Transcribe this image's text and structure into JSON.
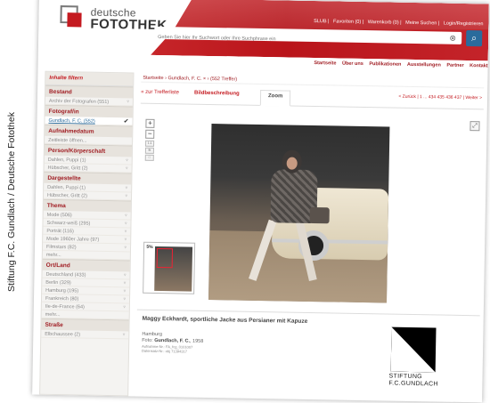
{
  "credit": "Stiftung F.C. Gundlach / Deutsche Fotothek",
  "logo": {
    "line1": "deutsche",
    "line2": "FOTOTHEK"
  },
  "topnav": [
    "SLUB",
    "Favoriten (0)",
    "Warenkorb (0)",
    "Meine Suchen",
    "Login/Registrieren"
  ],
  "search": {
    "placeholder": "Geben Sie hier Ihr Suchwort oder Ihre Suchphrase ein",
    "clear_icon": "close-icon",
    "button_icon": "search-icon"
  },
  "mainnav": [
    "Startseite",
    "Über uns",
    "Publikationen",
    "Ausstellungen",
    "Partner",
    "Kontakt"
  ],
  "sidebar": {
    "title": "Inhalte filtern",
    "sections": [
      {
        "label": "Bestand",
        "items": [
          {
            "text": "Archiv der Fotografen (551)",
            "mark": "▿"
          }
        ]
      },
      {
        "label": "Fotograf/in",
        "items": [
          {
            "text": "Gundlach, F. C. (552)",
            "mark": "✔",
            "active": true
          }
        ]
      },
      {
        "label": "Aufnahmedatum",
        "items": [
          {
            "text": "Zeitleiste öffnen...",
            "mark": ""
          }
        ]
      },
      {
        "label": "Person/Körperschaft",
        "items": [
          {
            "text": "Dahlen, Puppi (1)",
            "mark": "▿"
          },
          {
            "text": "Hübscher, Gritt (2)",
            "mark": "▿"
          }
        ]
      },
      {
        "label": "Dargestellte",
        "items": [
          {
            "text": "Dahlen, Puppi (1)",
            "mark": "▿"
          },
          {
            "text": "Hübscher, Gritt (2)",
            "mark": "▿"
          }
        ]
      },
      {
        "label": "Thema",
        "items": [
          {
            "text": "Mode (506)",
            "mark": "▿"
          },
          {
            "text": "Schwarz-weiß (295)",
            "mark": "▿"
          },
          {
            "text": "Porträt (116)",
            "mark": "▿"
          },
          {
            "text": "Mode 1960er Jahre (97)",
            "mark": "▿"
          },
          {
            "text": "Filmstars (82)",
            "mark": "▿"
          },
          {
            "text": "mehr...",
            "mark": ""
          }
        ]
      },
      {
        "label": "Ort/Land",
        "items": [
          {
            "text": "Deutschland (433)",
            "mark": "▿"
          },
          {
            "text": "Berlin (329)",
            "mark": "▿"
          },
          {
            "text": "Hamburg (195)",
            "mark": "▿"
          },
          {
            "text": "Frankreich (80)",
            "mark": "▿"
          },
          {
            "text": "Ile-de-France (64)",
            "mark": "▿"
          },
          {
            "text": "mehr...",
            "mark": ""
          }
        ]
      },
      {
        "label": "Straße",
        "items": [
          {
            "text": "Elbchaussee (2)",
            "mark": "▿"
          }
        ]
      }
    ]
  },
  "breadcrumb": "Startseite › Gundlach, F. C. × › (552 Treffer)",
  "tabs": {
    "back": "« zur Trefferliste",
    "description": "Bildbeschreibung",
    "zoom": "Zoom"
  },
  "pager": "< Zurück | 1 ... 434 435 436 437 | Weiter >",
  "zoom": {
    "plus": "+",
    "minus": "−",
    "small1": "1:1",
    "small2": "fit",
    "small3": "□",
    "fullscreen": "⤢",
    "thumb_pct": "5%"
  },
  "caption": {
    "title": "Maggy Eckhardt, sportliche Jacke aus Persianer mit Kapuze",
    "place": "Hamburg",
    "photo_label": "Foto:",
    "photographer": "Gundlach, F. C.",
    "year": "1958",
    "record1": "Aufnahme-Nr.: FA_fcg_0101007",
    "record2": "Datensatz-Nr.: obj 71394317",
    "stiftung1": "STIFTUNG",
    "stiftung2": "F.C.GUNDLACH"
  },
  "colors": {
    "brand_red": "#c41a20",
    "link_blue": "#2a6b9c",
    "sidebar_bg": "#f4f3f1"
  }
}
